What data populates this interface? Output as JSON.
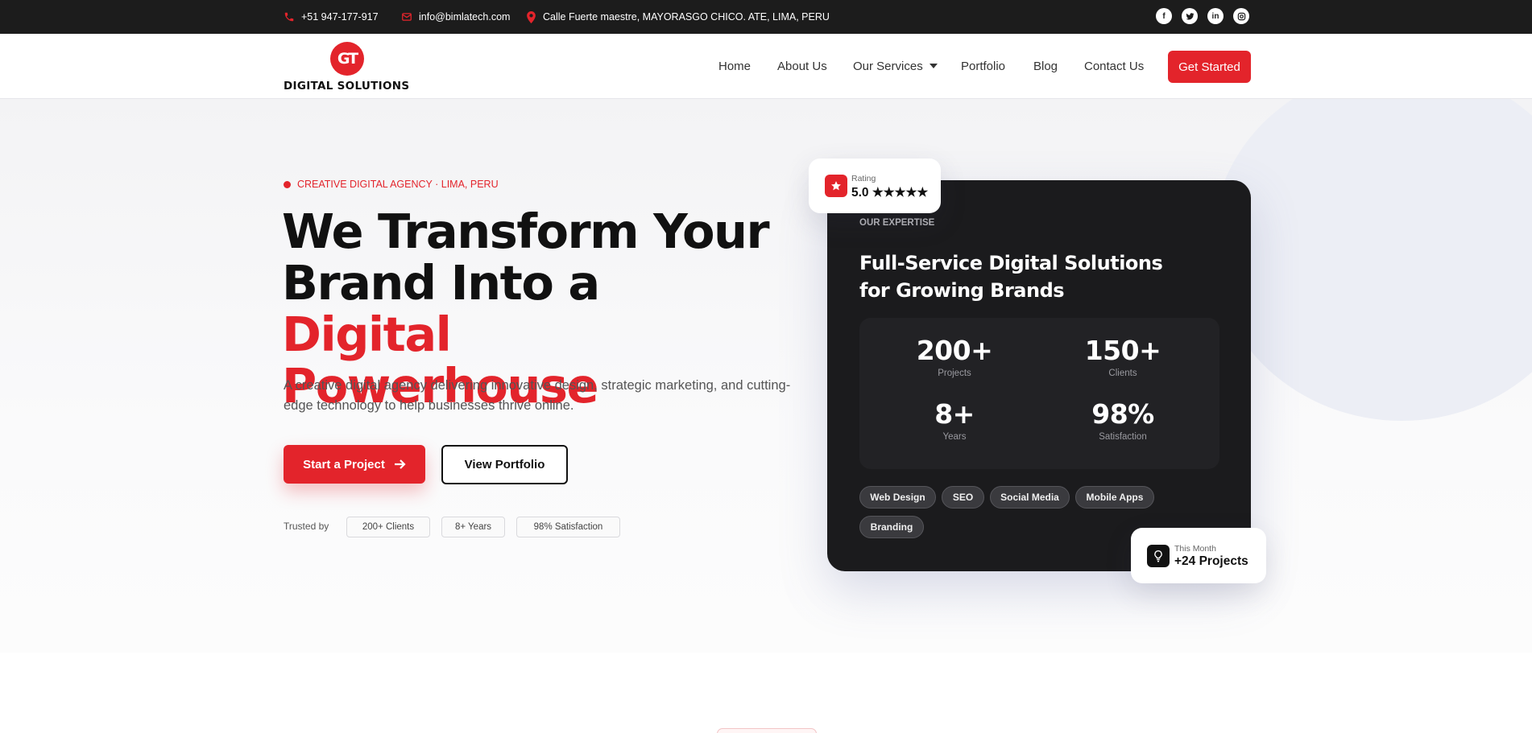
{
  "topbar": {
    "phone": "+51 947-177-917",
    "email": "info@bimlatech.com",
    "address": "Calle Fuerte maestre, MAYORASGO CHICO. ATE, LIMA, PERU",
    "social_icons": [
      "facebook-icon",
      "twitter-icon",
      "linkedin-icon",
      "instagram-icon"
    ]
  },
  "brand": {
    "logo_mark": "GT",
    "name": "DIGITAL SOLUTIONS",
    "accent": "#e3242b"
  },
  "nav": {
    "items": [
      {
        "label": "Home"
      },
      {
        "label": "About Us"
      },
      {
        "label": "Our Services"
      },
      {
        "label": "Portfolio"
      },
      {
        "label": "Blog"
      },
      {
        "label": "Contact Us"
      }
    ],
    "cta": "Get Started"
  },
  "hero": {
    "eyebrow": "CREATIVE DIGITAL AGENCY · LIMA, PERU",
    "headline_line1": "We Transform Your",
    "headline_line2": "Brand Into a ",
    "headline_red1": "Digital",
    "headline_red2": "Powerhouse",
    "subtitle": "A creative digital agency delivering innovative design, strategic marketing, and cutting-edge technology to help businesses thrive online.",
    "primary_button": "Start a Project",
    "secondary_button": "View Portfolio",
    "trusted_label": "Trusted by",
    "trust_chips": [
      "200+ Clients",
      "8+ Years",
      "98% Satisfaction"
    ]
  },
  "rating": {
    "label": "Rating",
    "value": "5.0 ★★★★★"
  },
  "card": {
    "eyebrow": "OUR EXPERTISE",
    "title": "Full-Service Digital Solutions for Growing Brands",
    "stats": [
      {
        "value": "200+",
        "label": "Projects"
      },
      {
        "value": "150+",
        "label": "Clients"
      },
      {
        "value": "8+",
        "label": "Years"
      },
      {
        "value": "98%",
        "label": "Satisfaction"
      }
    ],
    "tags": [
      "Web Design",
      "SEO",
      "Social Media",
      "Mobile Apps",
      "Branding"
    ]
  },
  "monthly": {
    "label": "This Month",
    "value": "+24 Projects"
  }
}
